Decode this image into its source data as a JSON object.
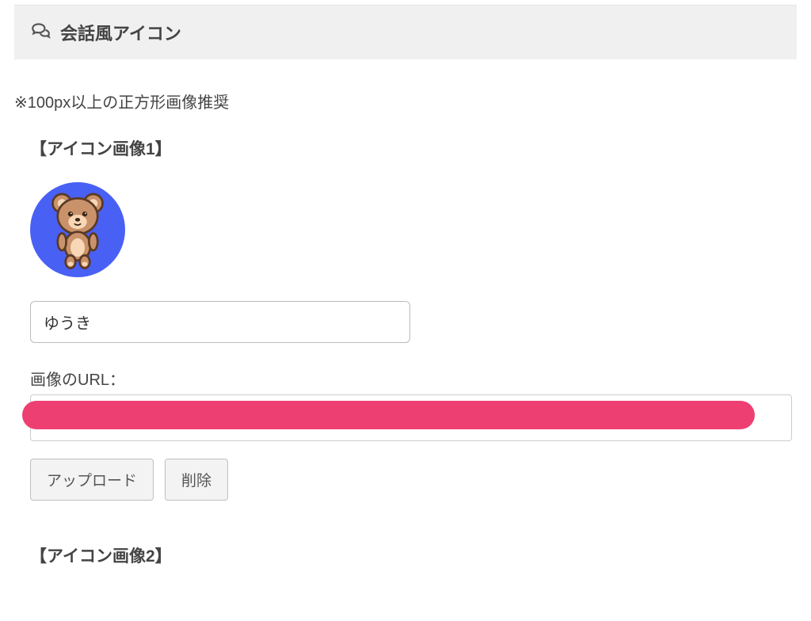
{
  "header": {
    "title": "会話風アイコン"
  },
  "hint": "※100px以上の正方形画像推奨",
  "icon1": {
    "title": "【アイコン画像1】",
    "name_value": "ゆうき",
    "url_label": "画像のURL：",
    "url_value": "",
    "upload_label": "アップロード",
    "delete_label": "削除"
  },
  "icon2": {
    "title": "【アイコン画像2】"
  }
}
